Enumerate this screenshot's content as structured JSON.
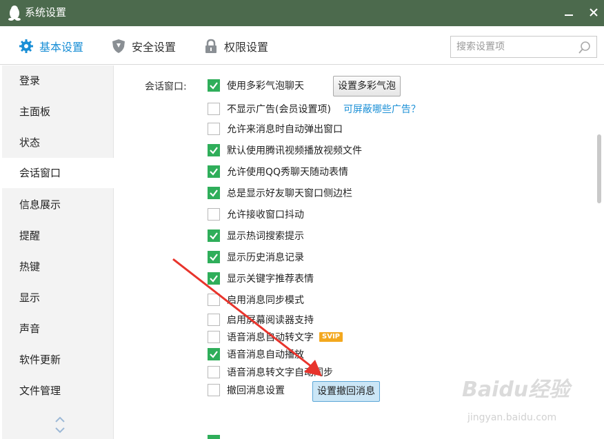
{
  "window": {
    "title": "系统设置",
    "icon": "penguin-icon",
    "minimize_icon": "minimize-icon",
    "close_icon": "close-icon",
    "title_bar_color": "#4c6a4d"
  },
  "toolbar": {
    "tabs": [
      {
        "label": "基本设置",
        "icon": "gear-icon",
        "active": true
      },
      {
        "label": "安全设置",
        "icon": "shield-icon",
        "active": false
      },
      {
        "label": "权限设置",
        "icon": "lock-icon",
        "active": false
      }
    ],
    "search_placeholder": "搜索设置项",
    "accent_color": "#1a8fd6"
  },
  "sidebar": {
    "items": [
      {
        "label": "登录"
      },
      {
        "label": "主面板"
      },
      {
        "label": "状态"
      },
      {
        "label": "会话窗口",
        "active": true
      },
      {
        "label": "信息展示"
      },
      {
        "label": "提醒"
      },
      {
        "label": "热键"
      },
      {
        "label": "显示"
      },
      {
        "label": "声音"
      },
      {
        "label": "软件更新"
      },
      {
        "label": "文件管理"
      }
    ]
  },
  "content": {
    "section_label": "会话窗口:",
    "options": [
      {
        "label": "使用多彩气泡聊天",
        "checked": true
      },
      {
        "label": "不显示广告(会员设置项)",
        "checked": false
      },
      {
        "label": "允许来消息时自动弹出窗口",
        "checked": false
      },
      {
        "label": "默认使用腾讯视频播放视频文件",
        "checked": true
      },
      {
        "label": "允许使用QQ秀聊天随动表情",
        "checked": true
      },
      {
        "label": "总是显示好友聊天窗口侧边栏",
        "checked": true
      },
      {
        "label": "允许接收窗口抖动",
        "checked": false
      },
      {
        "label": "显示热词搜索提示",
        "checked": true
      },
      {
        "label": "显示历史消息记录",
        "checked": true
      },
      {
        "label": "显示关键字推荐表情",
        "checked": true
      },
      {
        "label": "启用消息同步模式",
        "checked": false
      },
      {
        "label": "启用屏幕阅读器支持",
        "checked": false
      },
      {
        "label": "语音消息自动转文字",
        "checked": false
      },
      {
        "label": "语音消息自动播放",
        "checked": true
      },
      {
        "label": "语音消息转文字自动同步",
        "checked": false
      },
      {
        "label": "撤回消息设置",
        "checked": false
      }
    ],
    "bubble_button": "设置多彩气泡",
    "ad_link": "可屏蔽哪些广告？",
    "svip_badge": "SVIP",
    "recall_button": "设置撤回消息",
    "checked_color": "#2fae5a"
  },
  "watermark": {
    "text": "Baidu经验",
    "sub": "jingyan.baidu.com"
  }
}
